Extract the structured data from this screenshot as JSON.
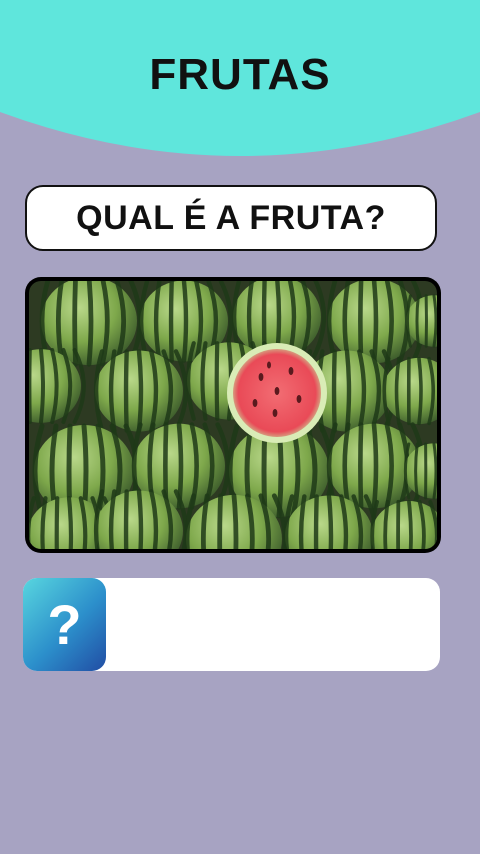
{
  "header": {
    "title": "FRUTAS",
    "bg_color": "#5fe6dc"
  },
  "question": {
    "text": "QUAL É A FRUTA?"
  },
  "image": {
    "subject": "watermelons"
  },
  "answer": {
    "icon": "question-mark-icon",
    "icon_text": "?",
    "value": ""
  },
  "colors": {
    "background": "#a7a3c2",
    "accent_gradient": [
      "#58d6df",
      "#214da4"
    ]
  }
}
